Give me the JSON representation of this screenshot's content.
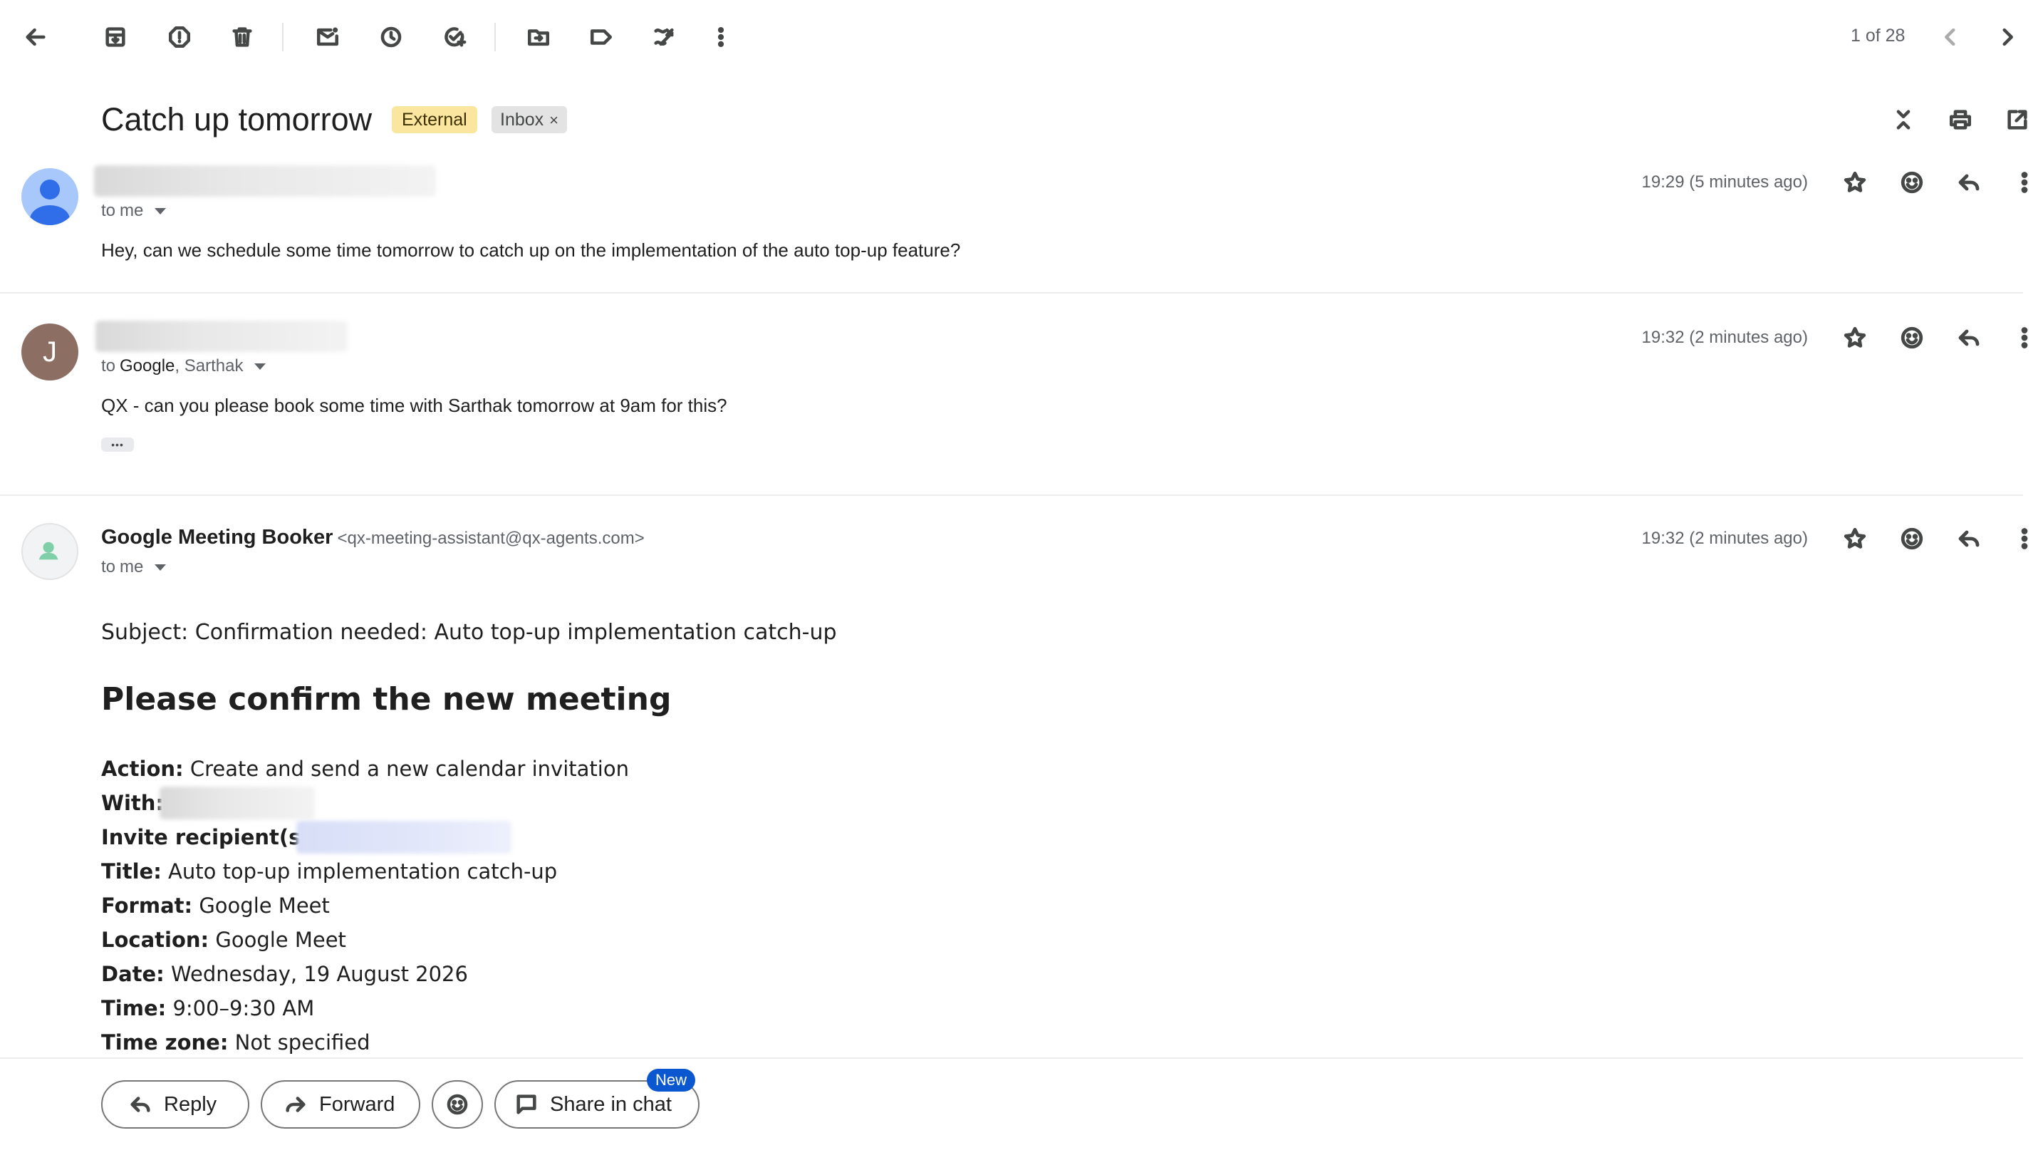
{
  "toolbar": {
    "counter": "1 of 28",
    "icons": [
      "back-arrow-icon",
      "archive-icon",
      "report-spam-icon",
      "delete-icon",
      "mark-unread-icon",
      "snooze-icon",
      "add-task-icon",
      "move-to-icon",
      "label-icon",
      "snippet-icon",
      "more-vert-icon",
      "prev-icon",
      "next-icon"
    ]
  },
  "thread": {
    "subject": "Catch up tomorrow",
    "chips": {
      "external": "External",
      "inbox": "Inbox",
      "inbox_remove": "×"
    }
  },
  "messages": [
    {
      "recipients_prefix": "to",
      "recipients": "me",
      "time": "19:29 (5 minutes ago)",
      "body": "Hey, can we schedule some time tomorrow to catch up on the implementation of the auto top-up feature?"
    },
    {
      "avatar_initial": "J",
      "recipients_prefix": "to",
      "recipients_primary": "Google",
      "recipients_rest": ", Sarthak",
      "time": "19:32 (2 minutes ago)",
      "body": "QX - can you please book some time with Sarthak tomorrow at 9am for this?",
      "ellipsis": "•••"
    },
    {
      "sender_name": "Google Meeting Booker",
      "sender_email": "<qx-meeting-assistant@qx-agents.com>",
      "recipients_prefix": "to",
      "recipients": "me",
      "time": "19:32 (2 minutes ago)",
      "subject_line": "Subject: Confirmation needed: Auto top-up implementation catch-up",
      "heading": "Please confirm the new meeting",
      "details": [
        {
          "label": "Action:",
          "value": "Create and send a new calendar invitation"
        },
        {
          "label": "With:",
          "value": ""
        },
        {
          "label": "Invite recipient(s):",
          "value": ""
        },
        {
          "label": "Title:",
          "value": "Auto top-up implementation catch-up"
        },
        {
          "label": "Format:",
          "value": "Google Meet"
        },
        {
          "label": "Location:",
          "value": "Google Meet"
        },
        {
          "label": "Date:",
          "value": "Wednesday, 19 August 2026"
        },
        {
          "label": "Time:",
          "value": "9:00–9:30 AM"
        },
        {
          "label": "Time zone:",
          "value": "Not specified"
        }
      ]
    }
  ],
  "actions": {
    "reply": "Reply",
    "forward": "Forward",
    "share_in_chat": "Share in chat",
    "new_badge": "New"
  }
}
